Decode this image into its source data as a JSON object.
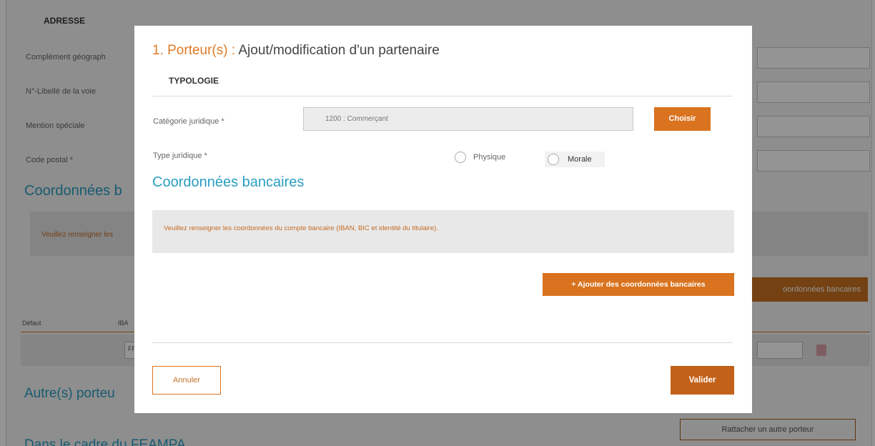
{
  "background": {
    "section_heading": "ADRESSE",
    "rows": [
      {
        "label": "Complément géograph"
      },
      {
        "label": "N°-Libellé de la voie"
      },
      {
        "label": "Mention spéciale"
      },
      {
        "label": "Code postal *"
      }
    ],
    "bank_title": "Coordonnées b",
    "info_text": "Veuillez renseigner les",
    "add_bank_button": "oordonnées bancaires",
    "table_headers": [
      "Défaut",
      "IBA"
    ],
    "row_input_prefix": "FR",
    "other_holders_title": "Autre(s) porteu",
    "attach_button": "Rattacher un autre porteur",
    "bottom_title": "Dans le cadre du FEAMPA"
  },
  "modal": {
    "title_accent": "1. Porteur(s) :",
    "title_rest": " Ajout/modification d'un partenaire",
    "subhead": "TYPOLOGIE",
    "legal_category_label": "Catégorie juridique *",
    "legal_category_value": "1200 : Commerçant",
    "choose_button": "Choisir",
    "legal_type_label": "Type juridique *",
    "radio_physical": "Physique",
    "radio_moral": "Morale",
    "bank_section_title": "Coordonnées bancaires",
    "bank_info_text": "Veuillez renseigner les coordonnées du compte bancaire (IBAN, BIC et identité du titulaire).",
    "add_bank_button": "+ Ajouter des coordonnées bancaires",
    "cancel_button": "Annuler",
    "validate_button": "Valider"
  },
  "colors": {
    "accent_orange": "#d9731f",
    "title_blue": "#2a9ec2",
    "dark_orange": "#c2621a"
  }
}
